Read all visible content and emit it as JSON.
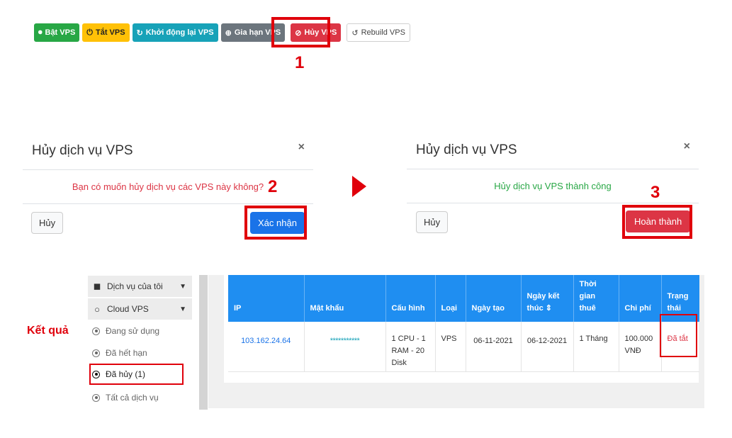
{
  "toolbar": {
    "buttons": [
      {
        "label": "Bật VPS",
        "icon": "toggle-on-icon"
      },
      {
        "label": "Tắt VPS",
        "icon": "power-icon"
      },
      {
        "label": "Khởi động lại VPS",
        "icon": "refresh-icon"
      },
      {
        "label": "Gia hạn VPS",
        "icon": "plus-circle-icon"
      },
      {
        "label": "Hủy VPS",
        "icon": "ban-icon"
      },
      {
        "label": "Rebuild VPS",
        "icon": "history-icon"
      }
    ]
  },
  "steps": {
    "one": "1",
    "two": "2",
    "three": "3"
  },
  "modal_confirm": {
    "title": "Hủy dịch vụ VPS",
    "close": "×",
    "message": "Bạn có muốn hủy dịch vụ các VPS này không?",
    "cancel_label": "Hủy",
    "confirm_label": "Xác nhận"
  },
  "modal_done": {
    "title": "Hủy dịch vụ VPS",
    "close": "×",
    "message": "Hủy dịch vụ VPS thành công",
    "cancel_label": "Hủy",
    "done_label": "Hoàn thành"
  },
  "result_label": "Kết quả",
  "sidebar": {
    "my_services": "Dịch vụ của tôi",
    "cloud_vps": "Cloud VPS",
    "sub_items": [
      "Đang sử dụng",
      "Đã hết hạn",
      "Đã hủy (1)",
      "Tất cả dịch vụ"
    ]
  },
  "table": {
    "headers": [
      "IP",
      "Mật khẩu",
      "Cấu hình",
      "Loại",
      "Ngày tạo",
      "Ngày kết thúc",
      "Thời gian thuê",
      "Chi phí",
      "Trạng thái"
    ],
    "row": {
      "ip": "103.162.24.64",
      "password": "***********",
      "config": "1 CPU - 1 RAM - 20 Disk",
      "type": "VPS",
      "created": "06-11-2021",
      "ends": "06-12-2021",
      "duration": "1 Tháng",
      "cost": "100.000 VNĐ",
      "status": "Đã tắt"
    }
  },
  "colors": {
    "highlight": "#e0000b",
    "primary": "#1f8ef1",
    "danger": "#dc3545",
    "success": "#28a745"
  }
}
